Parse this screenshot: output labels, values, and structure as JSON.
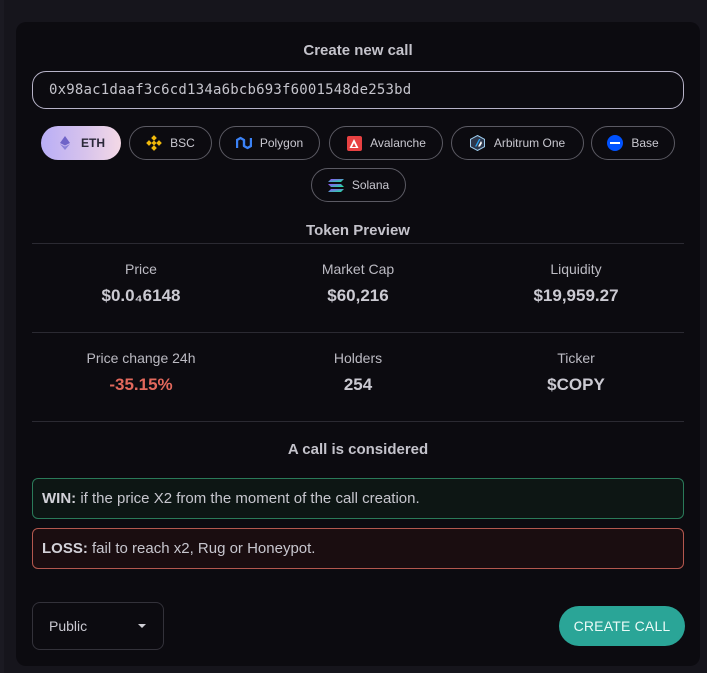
{
  "form": {
    "title": "Create new call",
    "address": "0x98ac1daaf3c6cd134a6bcb693f6001548de253bd"
  },
  "chains": [
    {
      "label": "ETH",
      "icon": "eth-icon",
      "active": true
    },
    {
      "label": "BSC",
      "icon": "bnb-icon",
      "active": false
    },
    {
      "label": "Polygon",
      "icon": "polygon-icon",
      "active": false
    },
    {
      "label": "Avalanche",
      "icon": "avalanche-icon",
      "active": false
    },
    {
      "label": "Arbitrum One",
      "icon": "arbitrum-icon",
      "active": false
    },
    {
      "label": "Base",
      "icon": "base-icon",
      "active": false
    },
    {
      "label": "Solana",
      "icon": "solana-icon",
      "active": false
    }
  ],
  "preview": {
    "title": "Token Preview",
    "price_label": "Price",
    "price_value": "$0.0₄6148",
    "mcap_label": "Market Cap",
    "mcap_value": "$60,216",
    "liq_label": "Liquidity",
    "liq_value": "$19,959.27",
    "change_label": "Price change 24h",
    "change_value": "-35.15%",
    "holders_label": "Holders",
    "holders_value": "254",
    "ticker_label": "Ticker",
    "ticker_value": "$COPY"
  },
  "rules": {
    "title": "A call is considered",
    "win_label": "WIN:",
    "win_text": "if the price X2 from the moment of the call creation.",
    "loss_label": "LOSS:",
    "loss_text": "fail to reach x2, Rug or Honeypot."
  },
  "footer": {
    "visibility": "Public",
    "create_label": "CREATE CALL"
  },
  "colors": {
    "accent": "#2aa597",
    "negative": "#e2685c",
    "win_border": "#2a7a59",
    "loss_border": "#b3574e"
  }
}
